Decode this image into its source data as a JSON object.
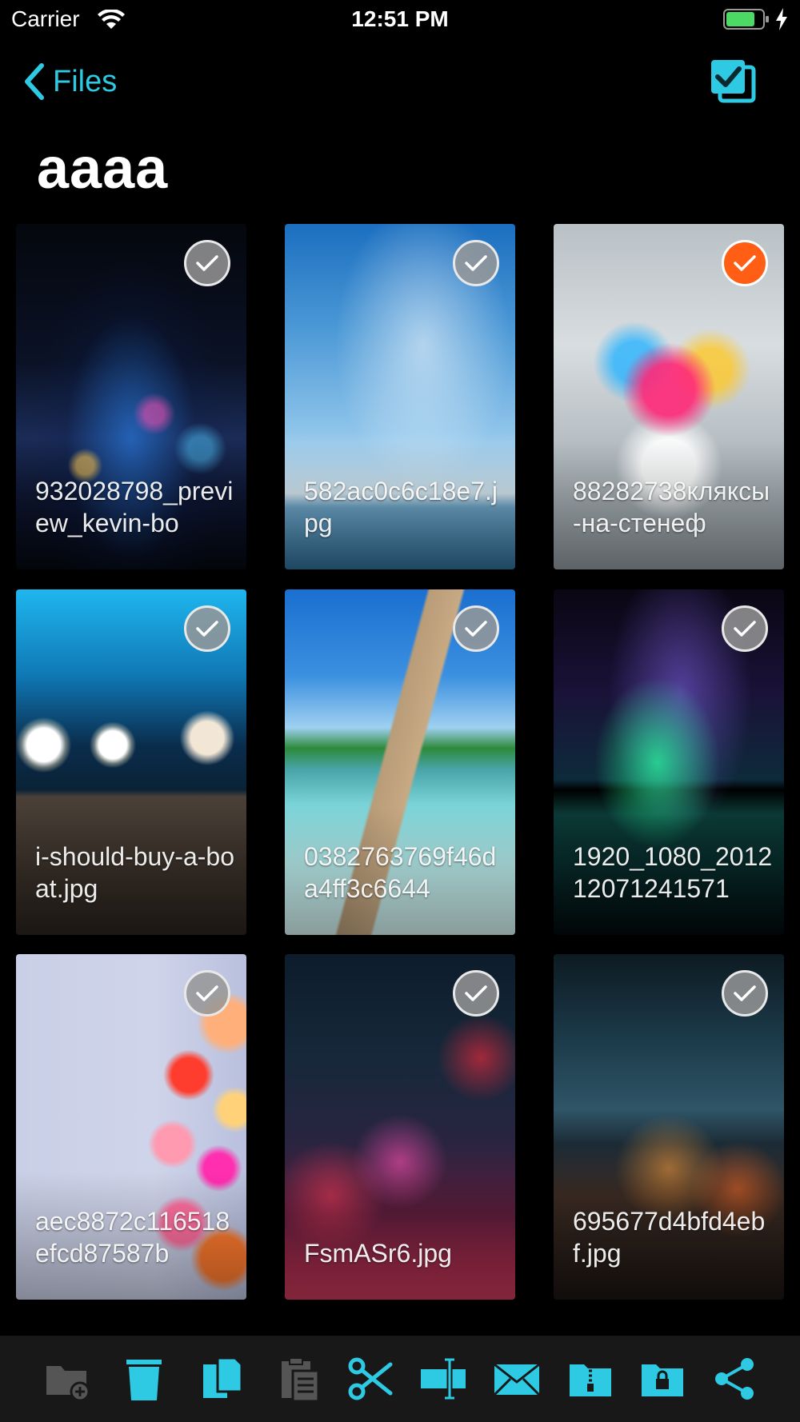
{
  "status_bar": {
    "carrier": "Carrier",
    "time": "12:51 PM",
    "battery_level": 0.8,
    "charging": true
  },
  "nav": {
    "back_label": "Files",
    "select_all_icon": "select-all-icon"
  },
  "title": "aaaa",
  "colors": {
    "accent": "#2ec9e3",
    "selected": "#ff5e14",
    "toolbar_bg": "#181818"
  },
  "files": [
    {
      "name": "932028798_preview_kevin-bo",
      "selected": false
    },
    {
      "name": "582ac0c6c18e7.jpg",
      "selected": false
    },
    {
      "name": "88282738кляксы-на-стенеф",
      "selected": true
    },
    {
      "name": "i-should-buy-a-boat.jpg",
      "selected": false
    },
    {
      "name": "0382763769f46da4ff3c6644",
      "selected": false
    },
    {
      "name": "1920_1080_201212071241571",
      "selected": false
    },
    {
      "name": "aec8872c116518efcd87587b",
      "selected": false
    },
    {
      "name": "FsmASr6.jpg",
      "selected": false
    },
    {
      "name": "695677d4bfd4ebf.jpg",
      "selected": false
    }
  ],
  "toolbar": [
    {
      "icon": "new-folder-icon",
      "enabled": false
    },
    {
      "icon": "trash-icon",
      "enabled": true
    },
    {
      "icon": "copy-icon",
      "enabled": true
    },
    {
      "icon": "paste-icon",
      "enabled": false
    },
    {
      "icon": "cut-icon",
      "enabled": true
    },
    {
      "icon": "rename-icon",
      "enabled": true
    },
    {
      "icon": "mail-icon",
      "enabled": true
    },
    {
      "icon": "zip-icon",
      "enabled": true
    },
    {
      "icon": "lock-icon",
      "enabled": true
    },
    {
      "icon": "share-icon",
      "enabled": true
    }
  ]
}
